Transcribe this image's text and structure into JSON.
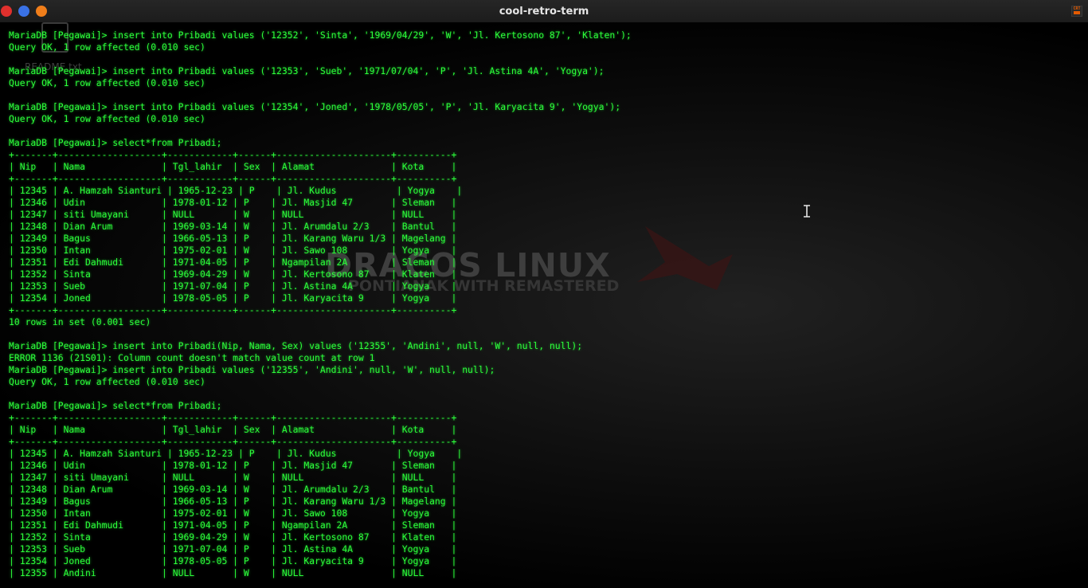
{
  "window": {
    "title": "cool-retro-term",
    "close_color": "#e0302d",
    "min_color": "#3a72e6",
    "max_color": "#f07e1a"
  },
  "app_icon_text": "CRT",
  "desktop": {
    "icon_label": "README.txt"
  },
  "wallpaper": {
    "title": "DRACOS LINUX",
    "subtitle": "PONTIANAK WITH REMASTERED"
  },
  "terminal": {
    "text_color": "#2cff3a",
    "lines": [
      "MariaDB [Pegawai]> insert into Pribadi values ('12352', 'Sinta', '1969/04/29', 'W', 'Jl. Kertosono 87', 'Klaten');",
      "Query OK, 1 row affected (0.010 sec)",
      "",
      "MariaDB [Pegawai]> insert into Pribadi values ('12353', 'Sueb', '1971/07/04', 'P', 'Jl. Astina 4A', 'Yogya');",
      "Query OK, 1 row affected (0.010 sec)",
      "",
      "MariaDB [Pegawai]> insert into Pribadi values ('12354', 'Joned', '1978/05/05', 'P', 'Jl. Karyacita 9', 'Yogya');",
      "Query OK, 1 row affected (0.010 sec)",
      "",
      "MariaDB [Pegawai]> select*from Pribadi;",
      "+-------+-------------------+------------+------+---------------------+----------+",
      "| Nip   | Nama              | Tgl_lahir  | Sex  | Alamat              | Kota     |",
      "+-------+-------------------+------------+------+---------------------+----------+",
      "| 12345 | A. Hamzah Sianturi | 1965-12-23 | P    | Jl. Kudus           | Yogya    |",
      "| 12346 | Udin              | 1978-01-12 | P    | Jl. Masjid 47       | Sleman   |",
      "| 12347 | siti Umayani      | NULL       | W    | NULL                | NULL     |",
      "| 12348 | Dian Arum         | 1969-03-14 | W    | Jl. Arumdalu 2/3    | Bantul   |",
      "| 12349 | Bagus             | 1966-05-13 | P    | Jl. Karang Waru 1/3 | Magelang |",
      "| 12350 | Intan             | 1975-02-01 | W    | Jl. Sawo 108        | Yogya    |",
      "| 12351 | Edi Dahmudi       | 1971-04-05 | P    | Ngampilan 2A        | Sleman   |",
      "| 12352 | Sinta             | 1969-04-29 | W    | Jl. Kertosono 87    | Klaten   |",
      "| 12353 | Sueb              | 1971-07-04 | P    | Jl. Astina 4A       | Yogya    |",
      "| 12354 | Joned             | 1978-05-05 | P    | Jl. Karyacita 9     | Yogya    |",
      "+-------+-------------------+------------+------+---------------------+----------+",
      "10 rows in set (0.001 sec)",
      "",
      "MariaDB [Pegawai]> insert into Pribadi(Nip, Nama, Sex) values ('12355', 'Andini', null, 'W', null, null);",
      "ERROR 1136 (21S01): Column count doesn't match value count at row 1",
      "MariaDB [Pegawai]> insert into Pribadi values ('12355', 'Andini', null, 'W', null, null);",
      "Query OK, 1 row affected (0.010 sec)",
      "",
      "MariaDB [Pegawai]> select*from Pribadi;",
      "+-------+-------------------+------------+------+---------------------+----------+",
      "| Nip   | Nama              | Tgl_lahir  | Sex  | Alamat              | Kota     |",
      "+-------+-------------------+------------+------+---------------------+----------+",
      "| 12345 | A. Hamzah Sianturi | 1965-12-23 | P    | Jl. Kudus           | Yogya    |",
      "| 12346 | Udin              | 1978-01-12 | P    | Jl. Masjid 47       | Sleman   |",
      "| 12347 | siti Umayani      | NULL       | W    | NULL                | NULL     |",
      "| 12348 | Dian Arum         | 1969-03-14 | W    | Jl. Arumdalu 2/3    | Bantul   |",
      "| 12349 | Bagus             | 1966-05-13 | P    | Jl. Karang Waru 1/3 | Magelang |",
      "| 12350 | Intan             | 1975-02-01 | W    | Jl. Sawo 108        | Yogya    |",
      "| 12351 | Edi Dahmudi       | 1971-04-05 | P    | Ngampilan 2A        | Sleman   |",
      "| 12352 | Sinta             | 1969-04-29 | W    | Jl. Kertosono 87    | Klaten   |",
      "| 12353 | Sueb              | 1971-07-04 | P    | Jl. Astina 4A       | Yogya    |",
      "| 12354 | Joned             | 1978-05-05 | P    | Jl. Karyacita 9     | Yogya    |",
      "| 12355 | Andini            | NULL       | W    | NULL                | NULL     |"
    ]
  }
}
